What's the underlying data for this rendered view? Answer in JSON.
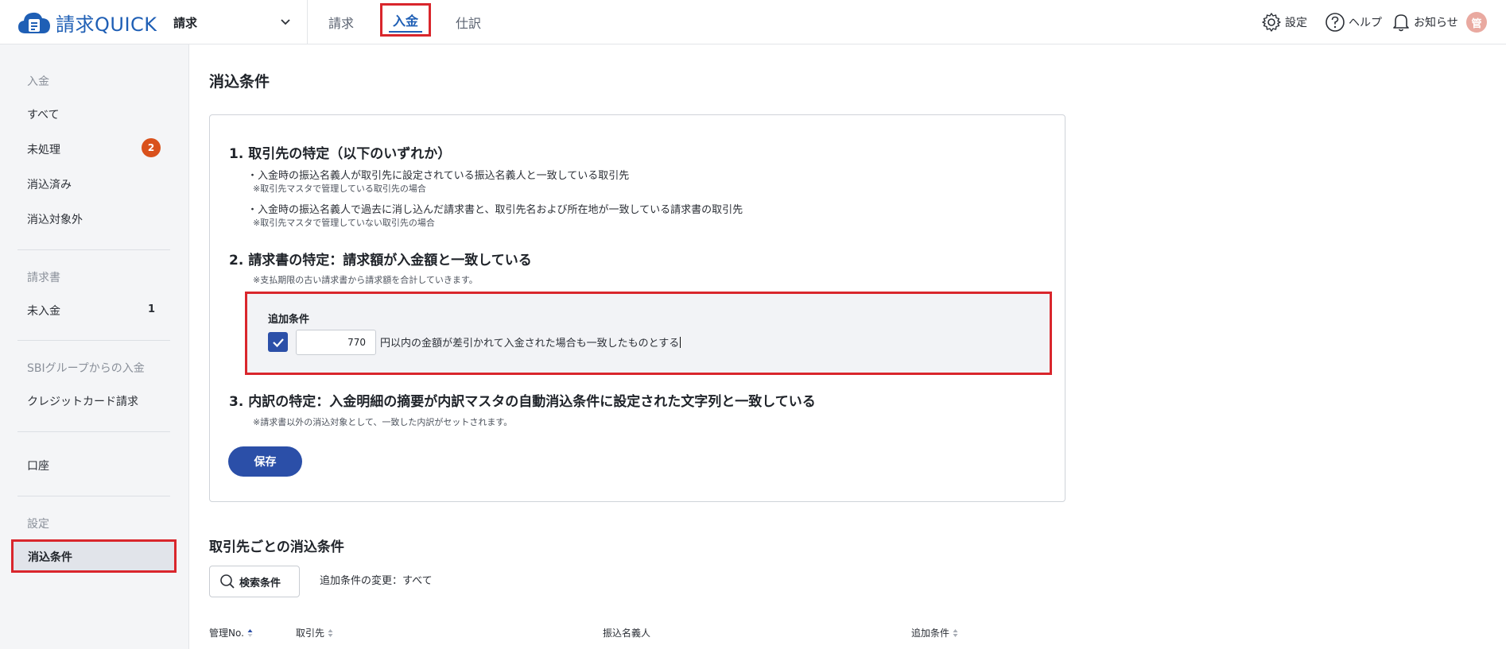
{
  "app": {
    "logo_text": "請求QUICK",
    "selector_label": "請求"
  },
  "nav": {
    "tabs": [
      {
        "label": "請求"
      },
      {
        "label": "入金"
      },
      {
        "label": "仕訳"
      }
    ]
  },
  "header_right": {
    "settings": "設定",
    "help": "ヘルプ",
    "notifications": "お知らせ",
    "avatar_initial": "管"
  },
  "sidebar": {
    "sections": {
      "payment": "入金",
      "invoice": "請求書",
      "sbi": "SBIグループからの入金",
      "settings": "設定"
    },
    "items": {
      "all": "すべて",
      "unprocessed": "未処理",
      "unprocessed_badge": "2",
      "reconciled": "消込済み",
      "excluded": "消込対象外",
      "unpaid": "未入金",
      "unpaid_count": "1",
      "credit_card": "クレジットカード請求",
      "account": "口座",
      "reconcile_conditions": "消込条件"
    }
  },
  "main": {
    "page_title": "消込条件",
    "step1": {
      "title": "1.  取引先の特定（以下のいずれか）",
      "bullet1": "・入金時の振込名義人が取引先に設定されている振込名義人と一致している取引先",
      "note1": "※取引先マスタで管理している取引先の場合",
      "bullet2": "・入金時の振込名義人で過去に消し込んだ請求書と、取引先名および所在地が一致している請求書の取引先",
      "note2": "※取引先マスタで管理していない取引先の場合"
    },
    "step2": {
      "title": "2.  請求書の特定：請求額が入金額と一致している",
      "note": "※支払期限の古い請求書から請求額を合計していきます。",
      "add_condition_label": "追加条件",
      "amount_value": "770",
      "amount_text": "円以内の金額が差引かれて入金された場合も一致したものとする"
    },
    "step3": {
      "title": "3.  内訳の特定：入金明細の摘要が内訳マスタの自動消込条件に設定された文字列と一致している",
      "note": "※請求書以外の消込対象として、一致した内訳がセットされます。"
    },
    "save_label": "保存",
    "section2_title": "取引先ごとの消込条件",
    "search_label": "検索条件",
    "filter_text": "追加条件の変更：すべて",
    "table_headers": [
      "管理No.",
      "取引先",
      "振込名義人",
      "追加条件"
    ]
  },
  "colors": {
    "accent": "#2b4fa8",
    "brand": "#1f5fb5",
    "highlight": "#d9262c",
    "badge": "#d9511c"
  }
}
